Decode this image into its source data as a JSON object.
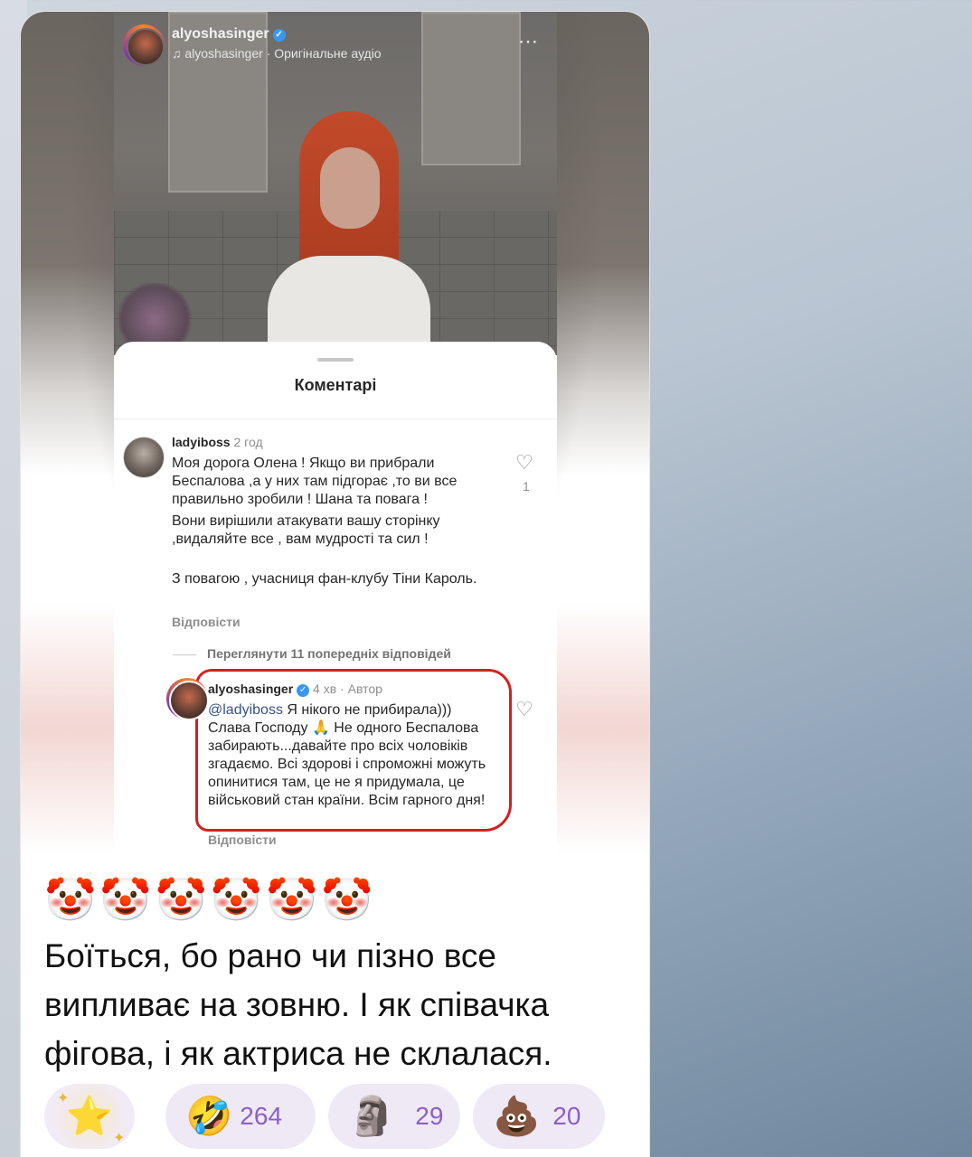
{
  "post": {
    "username": "alyoshasinger",
    "audio": "alyoshasinger · Оригінальне аудіо",
    "more_icon": "⋯"
  },
  "comments_sheet": {
    "title": "Коментарі",
    "comment1": {
      "username": "ladyiboss",
      "time": "2 год",
      "para1": "Моя дорога Олена ! Якщо ви прибрали Беспалова ,а у них там підгорає ,то ви все правильно зробили ! Шана та повага !",
      "para2": "Вони вирішили атакувати вашу сторінку ,видаляйте все , вам мудрості та сил !",
      "para3": "З повагою , учасниця фан-клубу Тіни Кароль.",
      "reply_label": "Відповісти",
      "likes": "1"
    },
    "view_replies": "Переглянути 11 попередніх відповідей",
    "reply1": {
      "username": "alyoshasinger",
      "time": "4 хв · Автор",
      "mention": "@ladyiboss",
      "text": "Я нікого не прибирала))) Слава Господу 🙏 Не одного Беспалова забирають...давайте про всіх чоловіків згадаємо. Всі здорові і спроможні можуть опинитися там, це не я придумала, це військовий стан країни. Всім гарного дня!",
      "reply_label": "Відповісти"
    }
  },
  "message": {
    "emojis": "🤡🤡🤡🤡🤡🤡",
    "text": "Боїться, бо рано чи пізно все випливає на зовню. І як співачка фігова, і як актриса не склалася."
  },
  "reactions": [
    {
      "emoji": "⭐",
      "count": ""
    },
    {
      "emoji": "🤣",
      "count": "264"
    },
    {
      "emoji": "🗿",
      "count": "29"
    },
    {
      "emoji": "💩",
      "count": "20"
    }
  ]
}
